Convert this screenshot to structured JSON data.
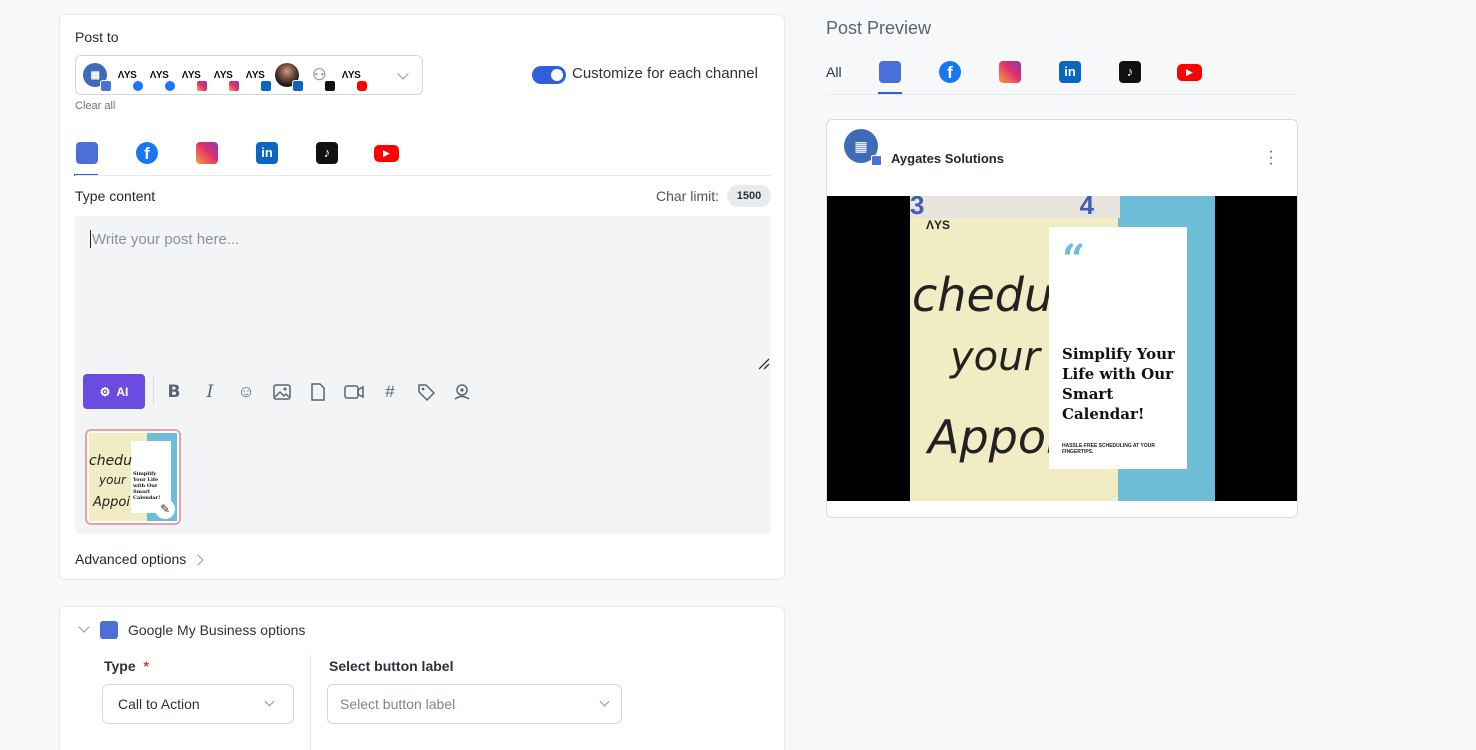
{
  "composer": {
    "post_to_label": "Post to",
    "clear_all": "Clear all",
    "customize_label": "Customize for each channel",
    "type_content_label": "Type content",
    "char_limit_label": "Char limit:",
    "char_limit_value": "1500",
    "placeholder": "Write your post here...",
    "ai_label": "AI",
    "advanced_options": "Advanced options",
    "accounts": [
      {
        "name": "gmb-account",
        "text": "",
        "badge": "gmb"
      },
      {
        "name": "ays-facebook-1",
        "text": "ΛYS",
        "badge": "facebook"
      },
      {
        "name": "ays-facebook-2",
        "text": "ΛYS",
        "badge": "facebook"
      },
      {
        "name": "ays-instagram-1",
        "text": "ΛYS",
        "badge": "instagram"
      },
      {
        "name": "ays-instagram-2",
        "text": "ΛYS",
        "badge": "instagram"
      },
      {
        "name": "ays-linkedin",
        "text": "ΛYS",
        "badge": "linkedin"
      },
      {
        "name": "photo-linkedin",
        "text": "",
        "badge": "linkedin"
      },
      {
        "name": "user-tiktok",
        "text": "",
        "badge": "tiktok"
      },
      {
        "name": "ays-youtube",
        "text": "ΛYS",
        "badge": "youtube"
      }
    ]
  },
  "preview": {
    "title": "Post Preview",
    "all_tab": "All",
    "account_name": "Aygates Solutions"
  },
  "creative": {
    "headline": "Simplify Your Life with Our Smart Calendar!",
    "subline": "HASSLE-FREE SCHEDULING AT YOUR FINGERTIPS.",
    "handwriting_1": "chedu",
    "handwriting_2": "your",
    "handwriting_3": "Appoi",
    "logo": "ΛYS",
    "numbers": "3  4"
  },
  "gmb_options": {
    "title": "Google My Business options",
    "type_label": "Type",
    "required_mark": "*",
    "type_value": "Call to Action",
    "button_label_title": "Select button label",
    "button_label_placeholder": "Select button label"
  },
  "colors": {
    "accent": "#2f5fdc",
    "ai": "#6a4de0",
    "facebook": "#1877f2",
    "linkedin": "#0a66c2",
    "youtube": "#ff0000",
    "tiktok": "#111111",
    "gmb": "#4a6fd8"
  }
}
